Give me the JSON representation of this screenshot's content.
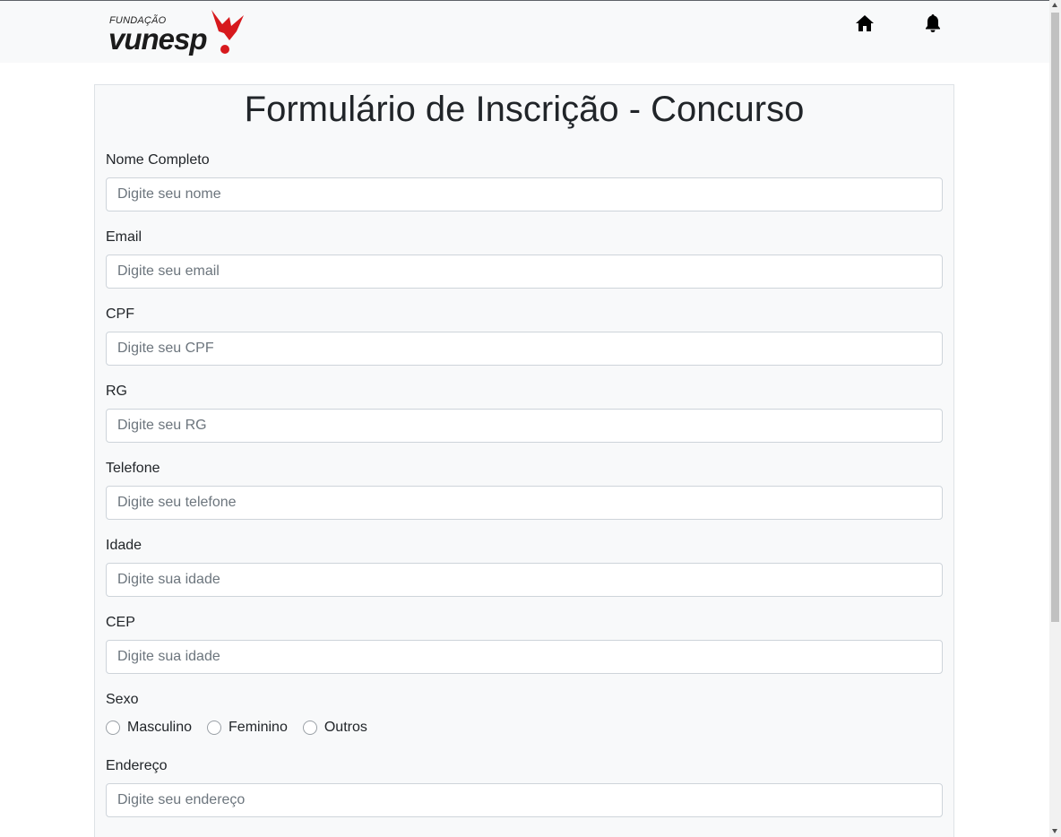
{
  "header": {
    "logo_small": "FUNDAÇÃO",
    "logo_big": "vunesp",
    "brand_color": "#d7191d",
    "icons": [
      "home-icon",
      "bell-icon"
    ]
  },
  "form": {
    "title": "Formulário de Inscrição - Concurso",
    "fields": [
      {
        "label": "Nome Completo",
        "placeholder": "Digite seu nome",
        "value": ""
      },
      {
        "label": "Email",
        "placeholder": "Digite seu email",
        "value": ""
      },
      {
        "label": "CPF",
        "placeholder": "Digite seu CPF",
        "value": ""
      },
      {
        "label": "RG",
        "placeholder": "Digite seu RG",
        "value": ""
      },
      {
        "label": "Telefone",
        "placeholder": "Digite seu telefone",
        "value": ""
      },
      {
        "label": "Idade",
        "placeholder": "Digite sua idade",
        "value": ""
      },
      {
        "label": "CEP",
        "placeholder": "Digite sua idade",
        "value": ""
      }
    ],
    "sexo": {
      "label": "Sexo",
      "options": [
        "Masculino",
        "Feminino",
        "Outros"
      ]
    },
    "endereco": {
      "label": "Endereço",
      "placeholder": "Digite seu endereço",
      "value": ""
    }
  }
}
